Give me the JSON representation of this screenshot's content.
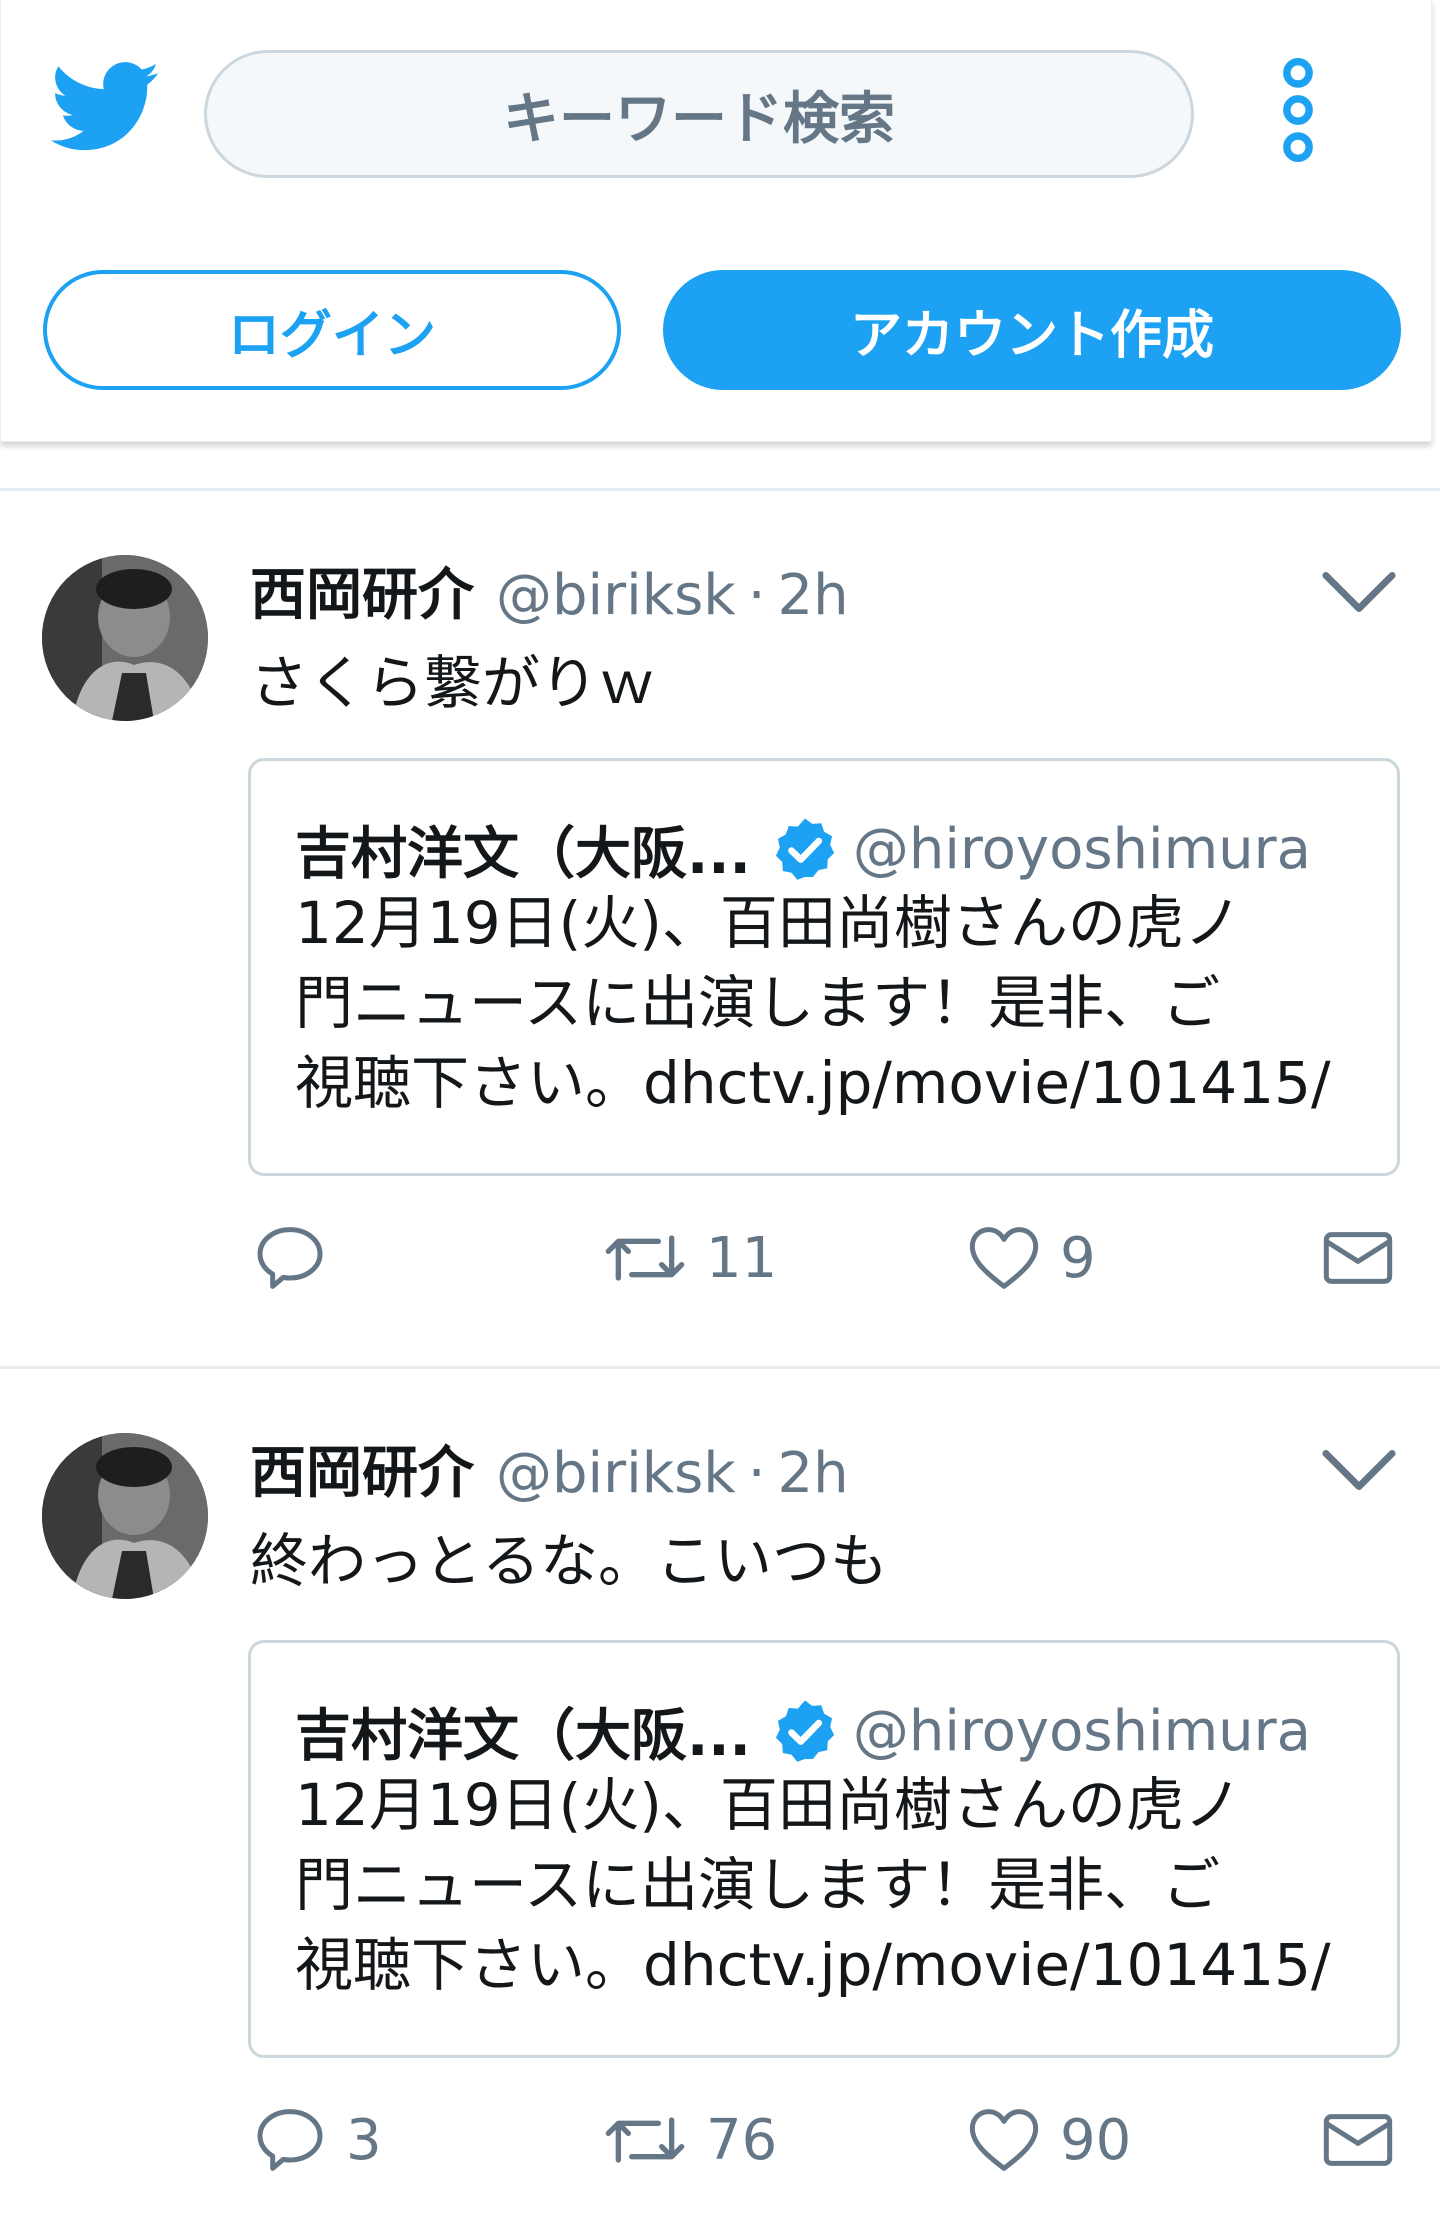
{
  "header": {
    "search_placeholder": "キーワード検索",
    "login_label": "ログイン",
    "signup_label": "アカウント作成"
  },
  "tweets": [
    {
      "name": "西岡研介",
      "handle": "@biriksk",
      "separator": "·",
      "time": "2h",
      "text": "さくら繋がりｗ",
      "quote": {
        "name": "吉村洋文（大阪...",
        "handle": "@hiroyoshimura",
        "text_lines": [
          "12月19日(火)、百田尚樹さんの虎ノ",
          "門ニュースに出演します！是非、ご",
          "視聴下さい。dhctv.jp/movie/101415/"
        ]
      },
      "reply_count": "",
      "retweet_count": "11",
      "like_count": "9"
    },
    {
      "name": "西岡研介",
      "handle": "@biriksk",
      "separator": "·",
      "time": "2h",
      "text": "終わっとるな。こいつも",
      "quote": {
        "name": "吉村洋文（大阪...",
        "handle": "@hiroyoshimura",
        "text_lines": [
          "12月19日(火)、百田尚樹さんの虎ノ",
          "門ニュースに出演します！是非、ご",
          "視聴下さい。dhctv.jp/movie/101415/"
        ]
      },
      "reply_count": "3",
      "retweet_count": "76",
      "like_count": "90"
    }
  ],
  "colors": {
    "accent": "#1da1f2",
    "muted": "#657786",
    "border": "#ccd6dd"
  },
  "icons": [
    "twitter-bird-icon",
    "more-vertical-icon",
    "chevron-down-icon",
    "verified-badge-icon",
    "reply-icon",
    "retweet-icon",
    "like-icon",
    "message-icon"
  ]
}
